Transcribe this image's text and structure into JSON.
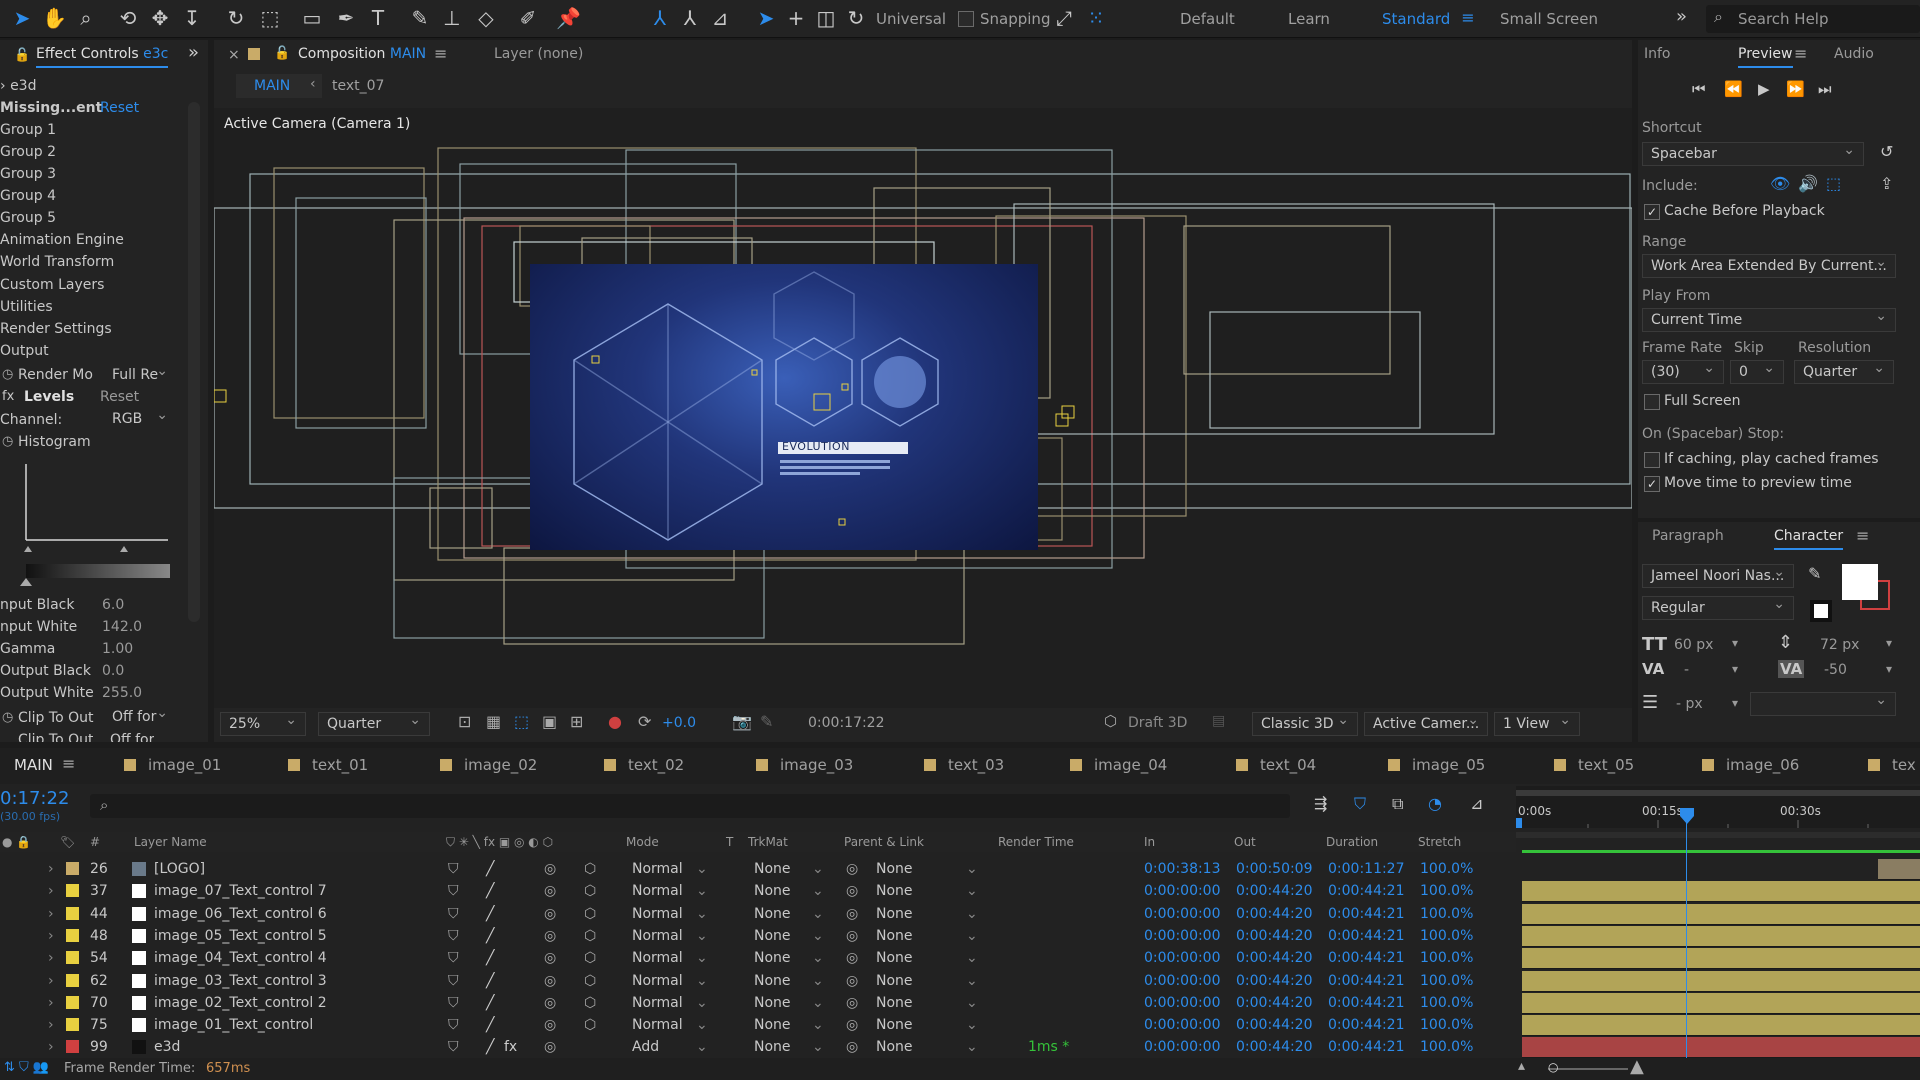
{
  "toolbar": {
    "universal_label": "Universal",
    "snapping_label": "Snapping",
    "workspaces": [
      "Default",
      "Learn",
      "Standard",
      "Small Screen"
    ],
    "active_workspace": "Standard",
    "more": "»",
    "search_placeholder": "Search Help"
  },
  "effect_controls": {
    "tab_label": "Effect Controls",
    "tab_layer": "e3c",
    "layer_name": "e3d",
    "rows": [
      {
        "label": "Missing...ent",
        "value": "Reset"
      },
      {
        "label": "Group 1"
      },
      {
        "label": "Group 2"
      },
      {
        "label": "Group 3"
      },
      {
        "label": "Group 4"
      },
      {
        "label": "Group 5"
      },
      {
        "label": "Animation Engine"
      },
      {
        "label": "World Transform"
      },
      {
        "label": "Custom Layers"
      },
      {
        "label": "Utilities"
      },
      {
        "label": "Render Settings"
      },
      {
        "label": "Output"
      }
    ],
    "render_mode_label": "Render Mo",
    "render_mode_value": "Full Re",
    "levels_label": "Levels",
    "levels_reset": "Reset",
    "channel_label": "Channel:",
    "channel_value": "RGB",
    "histogram_label": "Histogram",
    "params": [
      {
        "label": "nput Black",
        "value": "6.0"
      },
      {
        "label": "nput White",
        "value": "142.0"
      },
      {
        "label": "Gamma",
        "value": "1.00"
      },
      {
        "label": "Output Black",
        "value": "0.0"
      },
      {
        "label": "Output White",
        "value": "255.0"
      }
    ],
    "clip_label": "Clip To Out",
    "clip_value": "Off for",
    "clip2_label": "Clip To Out",
    "clip2_value": "Off for"
  },
  "composition": {
    "tab_label": "Composition",
    "comp_name": "MAIN",
    "layer_tab": "Layer (none)",
    "breadcrumb_main": "MAIN",
    "breadcrumb_child": "text_07",
    "camera_label": "Active Camera (Camera 1)",
    "overlay_text": "EVOLUTION",
    "zoom": "25%",
    "resolution": "Quarter",
    "exposure": "+0.0",
    "timecode": "0:00:17:22",
    "draft3d": "Draft 3D",
    "renderer": "Classic 3D",
    "view": "Active Camer...",
    "views": "1 View"
  },
  "preview": {
    "tabs": [
      "Info",
      "Preview",
      "Audio"
    ],
    "active_tab": "Preview",
    "shortcut_label": "Shortcut",
    "shortcut_value": "Spacebar",
    "include_label": "Include:",
    "cache_label": "Cache Before Playback",
    "range_label": "Range",
    "range_value": "Work Area Extended By Current...",
    "playfrom_label": "Play From",
    "playfrom_value": "Current Time",
    "framerate_label": "Frame Rate",
    "skip_label": "Skip",
    "resolution_label": "Resolution",
    "framerate_value": "(30)",
    "skip_value": "0",
    "resolution_value": "Quarter",
    "fullscreen_label": "Full Screen",
    "stop_label": "On (Spacebar) Stop:",
    "cached_label": "If caching, play cached frames",
    "movetime_label": "Move time to preview time"
  },
  "character": {
    "tabs": [
      "Paragraph",
      "Character"
    ],
    "active_tab": "Character",
    "font": "Jameel Noori Nas...",
    "style": "Regular",
    "size": "60 px",
    "leading": "72 px",
    "kerning": "-",
    "tracking": "-50",
    "stroke": "- px"
  },
  "timeline": {
    "comp_tab": "MAIN",
    "comp_tabs": [
      "image_01",
      "text_01",
      "image_02",
      "text_02",
      "image_03",
      "text_03",
      "image_04",
      "text_04",
      "image_05",
      "text_05",
      "image_06",
      "tex"
    ],
    "current_time": "0:17:22",
    "fps": "(30.00 fps)",
    "ruler": [
      "0:00s",
      "00:15s",
      "00:30s"
    ],
    "columns": {
      "num": "#",
      "layer_name": "Layer Name",
      "mode": "Mode",
      "t": "T",
      "trkmat": "TrkMat",
      "parent": "Parent & Link",
      "render_time": "Render Time",
      "in": "In",
      "out": "Out",
      "duration": "Duration",
      "stretch": "Stretch"
    },
    "layers": [
      {
        "num": "26",
        "name": "[LOGO]",
        "mode": "Normal",
        "trkmat": "None",
        "parent": "None",
        "render": "",
        "in": "0:00:38:13",
        "out": "0:00:50:09",
        "dur": "0:00:11:27",
        "stretch": "100.0%",
        "color": "#c9ab68"
      },
      {
        "num": "37",
        "name": "image_07_Text_control 7",
        "mode": "Normal",
        "trkmat": "None",
        "parent": "None",
        "render": "",
        "in": "0:00:00:00",
        "out": "0:00:44:20",
        "dur": "0:00:44:21",
        "stretch": "100.0%",
        "color": "#e8d040"
      },
      {
        "num": "44",
        "name": "image_06_Text_control 6",
        "mode": "Normal",
        "trkmat": "None",
        "parent": "None",
        "render": "",
        "in": "0:00:00:00",
        "out": "0:00:44:20",
        "dur": "0:00:44:21",
        "stretch": "100.0%",
        "color": "#e8d040"
      },
      {
        "num": "48",
        "name": "image_05_Text_control 5",
        "mode": "Normal",
        "trkmat": "None",
        "parent": "None",
        "render": "",
        "in": "0:00:00:00",
        "out": "0:00:44:20",
        "dur": "0:00:44:21",
        "stretch": "100.0%",
        "color": "#e8d040"
      },
      {
        "num": "54",
        "name": "image_04_Text_control 4",
        "mode": "Normal",
        "trkmat": "None",
        "parent": "None",
        "render": "",
        "in": "0:00:00:00",
        "out": "0:00:44:20",
        "dur": "0:00:44:21",
        "stretch": "100.0%",
        "color": "#e8d040"
      },
      {
        "num": "62",
        "name": "image_03_Text_control 3",
        "mode": "Normal",
        "trkmat": "None",
        "parent": "None",
        "render": "",
        "in": "0:00:00:00",
        "out": "0:00:44:20",
        "dur": "0:00:44:21",
        "stretch": "100.0%",
        "color": "#e8d040"
      },
      {
        "num": "70",
        "name": "image_02_Text_control 2",
        "mode": "Normal",
        "trkmat": "None",
        "parent": "None",
        "render": "",
        "in": "0:00:00:00",
        "out": "0:00:44:20",
        "dur": "0:00:44:21",
        "stretch": "100.0%",
        "color": "#e8d040"
      },
      {
        "num": "75",
        "name": "image_01_Text_control",
        "mode": "Normal",
        "trkmat": "None",
        "parent": "None",
        "render": "",
        "in": "0:00:00:00",
        "out": "0:00:44:20",
        "dur": "0:00:44:21",
        "stretch": "100.0%",
        "color": "#e8d040"
      },
      {
        "num": "99",
        "name": "e3d",
        "mode": "Add",
        "trkmat": "None",
        "parent": "None",
        "render": "1ms *",
        "in": "0:00:00:00",
        "out": "0:00:44:20",
        "dur": "0:00:44:21",
        "stretch": "100.0%",
        "color": "#d04040"
      }
    ],
    "frame_render_label": "Frame Render Time:",
    "frame_render_value": "657ms"
  },
  "colors": {
    "accent": "#2d8ceb",
    "bar_yellow": "#b2a458",
    "bar_red": "#a84444",
    "work_area": "#35c23a"
  }
}
